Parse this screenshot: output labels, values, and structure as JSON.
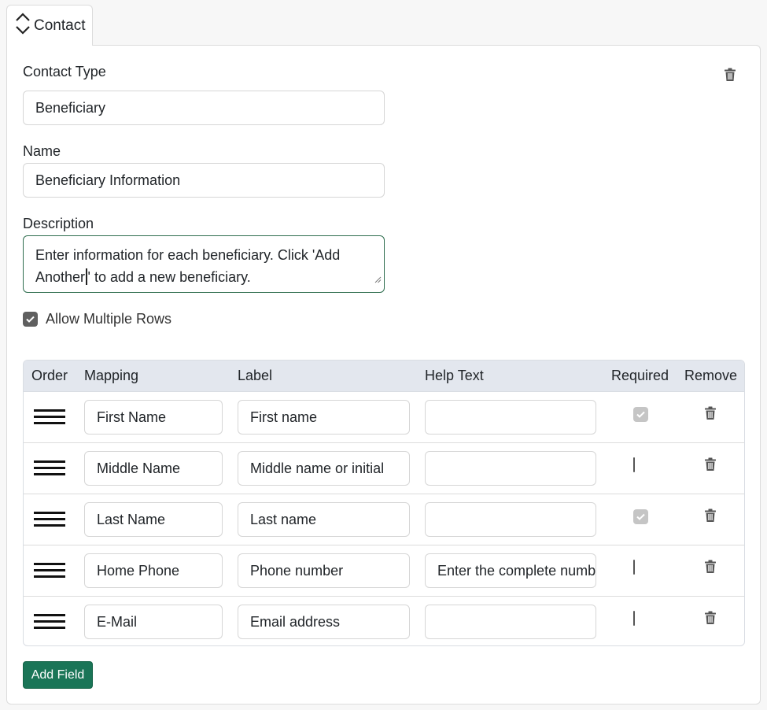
{
  "tab": {
    "label": "Contact",
    "icon": "expand-collapse-icon"
  },
  "form": {
    "contact_type": {
      "label": "Contact Type",
      "value": "Beneficiary"
    },
    "name": {
      "label": "Name",
      "value": "Beneficiary Information"
    },
    "description": {
      "label": "Description",
      "value_before_cursor": "Enter information for each beneficiary. Click 'Add Another",
      "value_after_cursor": "' to add a new beneficiary."
    },
    "allow_multiple_rows": {
      "label": "Allow Multiple Rows",
      "checked": true
    }
  },
  "table": {
    "headers": {
      "order": "Order",
      "mapping": "Mapping",
      "label": "Label",
      "help_text": "Help Text",
      "required": "Required",
      "remove": "Remove"
    },
    "rows": [
      {
        "mapping": "First Name",
        "label": "First name",
        "help_text": "",
        "required": "checked-disabled"
      },
      {
        "mapping": "Middle Name",
        "label": "Middle name or initial",
        "help_text": "",
        "required": "unchecked"
      },
      {
        "mapping": "Last Name",
        "label": "Last name",
        "help_text": "",
        "required": "checked-disabled"
      },
      {
        "mapping": "Home Phone",
        "label": "Phone number",
        "help_text": "Enter the complete number",
        "required": "unchecked"
      },
      {
        "mapping": "E-Mail",
        "label": "Email address",
        "help_text": "",
        "required": "unchecked"
      }
    ]
  },
  "actions": {
    "add_field_label": "Add Field"
  },
  "icons": {
    "delete": "trash-icon",
    "drag": "drag-handle-icon",
    "resize": "resize-grip-icon",
    "check": "checkmark-icon"
  },
  "colors": {
    "primary_button": "#1a7557",
    "table_header_bg": "#e3e7ee",
    "focus_border": "#2f6e4f",
    "checkbox_checked": "#5f5f5f",
    "checkbox_disabled": "#c5c5c5"
  }
}
